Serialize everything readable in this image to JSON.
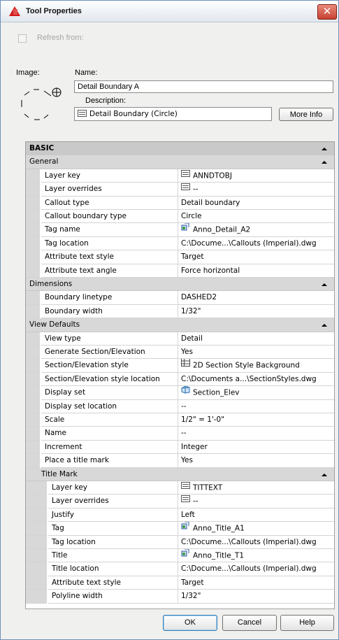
{
  "window": {
    "title": "Tool Properties",
    "close_glyph": "✕"
  },
  "refresh": {
    "label": "Refresh from:",
    "checked": false,
    "enabled": false
  },
  "image_label": "Image:",
  "name": {
    "label": "Name:",
    "value": "Detail Boundary A"
  },
  "description": {
    "label": "Description:",
    "value": "Detail Boundary (Circle)"
  },
  "more_info_label": "More Info",
  "properties": [
    {
      "type": "cat",
      "level": 0,
      "label": "BASIC"
    },
    {
      "type": "cat",
      "level": 1,
      "label": "General"
    },
    {
      "type": "prop",
      "level": 2,
      "name": "Layer key",
      "value": "ANNDTOBJ",
      "icon": "layer-key-icon"
    },
    {
      "type": "prop",
      "level": 2,
      "name": "Layer overrides",
      "value": "--",
      "icon": "layer-key-icon"
    },
    {
      "type": "prop",
      "level": 2,
      "name": "Callout type",
      "value": "Detail boundary"
    },
    {
      "type": "prop",
      "level": 2,
      "name": "Callout boundary type",
      "value": "Circle"
    },
    {
      "type": "prop",
      "level": 2,
      "name": "Tag name",
      "value": "Anno_Detail_A2",
      "icon": "block-icon"
    },
    {
      "type": "prop",
      "level": 2,
      "name": "Tag location",
      "value": "C:\\Docume...\\Callouts (Imperial).dwg"
    },
    {
      "type": "prop",
      "level": 2,
      "name": "Attribute text style",
      "value": "Target"
    },
    {
      "type": "prop",
      "level": 2,
      "name": "Attribute text angle",
      "value": "Force horizontal"
    },
    {
      "type": "cat",
      "level": 1,
      "label": "Dimensions"
    },
    {
      "type": "prop",
      "level": 2,
      "name": "Boundary linetype",
      "value": "DASHED2"
    },
    {
      "type": "prop",
      "level": 2,
      "name": "Boundary width",
      "value": "1/32\""
    },
    {
      "type": "cat",
      "level": 1,
      "label": "View Defaults"
    },
    {
      "type": "prop",
      "level": 2,
      "name": "View type",
      "value": "Detail"
    },
    {
      "type": "prop",
      "level": 2,
      "name": "Generate Section/Elevation",
      "value": "Yes"
    },
    {
      "type": "prop",
      "level": 2,
      "name": "Section/Elevation style",
      "value": "2D Section Style Background",
      "icon": "section-style-icon"
    },
    {
      "type": "prop",
      "level": 2,
      "name": "Section/Elevation style location",
      "value": "C:\\Documents a...\\SectionStyles.dwg"
    },
    {
      "type": "prop",
      "level": 2,
      "name": "Display set",
      "value": "Section_Elev",
      "icon": "display-set-icon"
    },
    {
      "type": "prop",
      "level": 2,
      "name": "Display set location",
      "value": "--"
    },
    {
      "type": "prop",
      "level": 2,
      "name": "Scale",
      "value": "1/2\" = 1'-0\""
    },
    {
      "type": "prop",
      "level": 2,
      "name": "Name",
      "value": "--"
    },
    {
      "type": "prop",
      "level": 2,
      "name": "Increment",
      "value": "Integer"
    },
    {
      "type": "prop",
      "level": 2,
      "name": "Place a title mark",
      "value": "Yes"
    },
    {
      "type": "cat",
      "level": 2,
      "label": "Title Mark"
    },
    {
      "type": "prop",
      "level": 3,
      "name": "Layer key",
      "value": "TITTEXT",
      "icon": "layer-key-icon"
    },
    {
      "type": "prop",
      "level": 3,
      "name": "Layer overrides",
      "value": "--",
      "icon": "layer-key-icon"
    },
    {
      "type": "prop",
      "level": 3,
      "name": "Justify",
      "value": "Left"
    },
    {
      "type": "prop",
      "level": 3,
      "name": "Tag",
      "value": "Anno_Title_A1",
      "icon": "block-icon"
    },
    {
      "type": "prop",
      "level": 3,
      "name": "Tag location",
      "value": "C:\\Docume...\\Callouts (Imperial).dwg"
    },
    {
      "type": "prop",
      "level": 3,
      "name": "Title",
      "value": "Anno_Title_T1",
      "icon": "block-icon"
    },
    {
      "type": "prop",
      "level": 3,
      "name": "Title location",
      "value": "C:\\Docume...\\Callouts (Imperial).dwg"
    },
    {
      "type": "prop",
      "level": 3,
      "name": "Attribute text style",
      "value": "Target"
    },
    {
      "type": "prop",
      "level": 3,
      "name": "Polyline width",
      "value": "1/32\""
    }
  ],
  "buttons": {
    "ok": "OK",
    "cancel": "Cancel",
    "help": "Help"
  }
}
